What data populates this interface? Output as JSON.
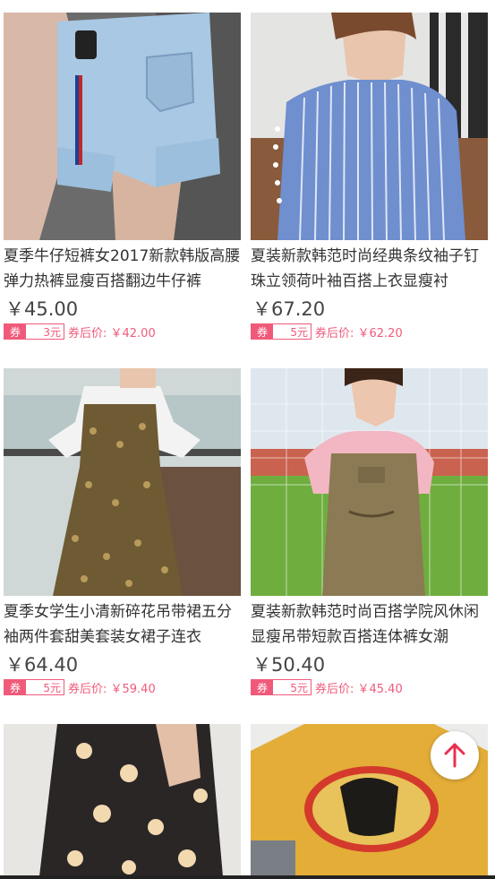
{
  "products": [
    {
      "title": "夏季牛仔短裤女2017新款韩版高腰弹力热裤显瘦百搭翻边牛仔裤",
      "price": "￥45.00",
      "coupon_tag": "券",
      "coupon_amount": "3元",
      "after_coupon": "券后价: ￥42.00",
      "image_desc": "denim-shorts"
    },
    {
      "title": "夏装新款韩范时尚经典条纹袖子钉珠立领荷叶袖百搭上衣显瘦衬",
      "price": "￥67.20",
      "coupon_tag": "券",
      "coupon_amount": "5元",
      "after_coupon": "券后价: ￥62.20",
      "image_desc": "striped-shirt"
    },
    {
      "title": "夏季女学生小清新碎花吊带裙五分袖两件套甜美套装女裙子连衣",
      "price": "￥64.40",
      "coupon_tag": "券",
      "coupon_amount": "5元",
      "after_coupon": "券后价: ￥59.40",
      "image_desc": "floral-dress"
    },
    {
      "title": "夏装新款韩范时尚百搭学院风休闲显瘦吊带短款百搭连体裤女潮",
      "price": "￥50.40",
      "coupon_tag": "券",
      "coupon_amount": "5元",
      "after_coupon": "券后价: ￥45.40",
      "image_desc": "overall-jumpsuit"
    }
  ],
  "colors": {
    "coupon": "#f05a7a",
    "back_to_top_arrow": "#e8304f"
  },
  "icons": {
    "back_to_top": "arrow-up-icon"
  }
}
